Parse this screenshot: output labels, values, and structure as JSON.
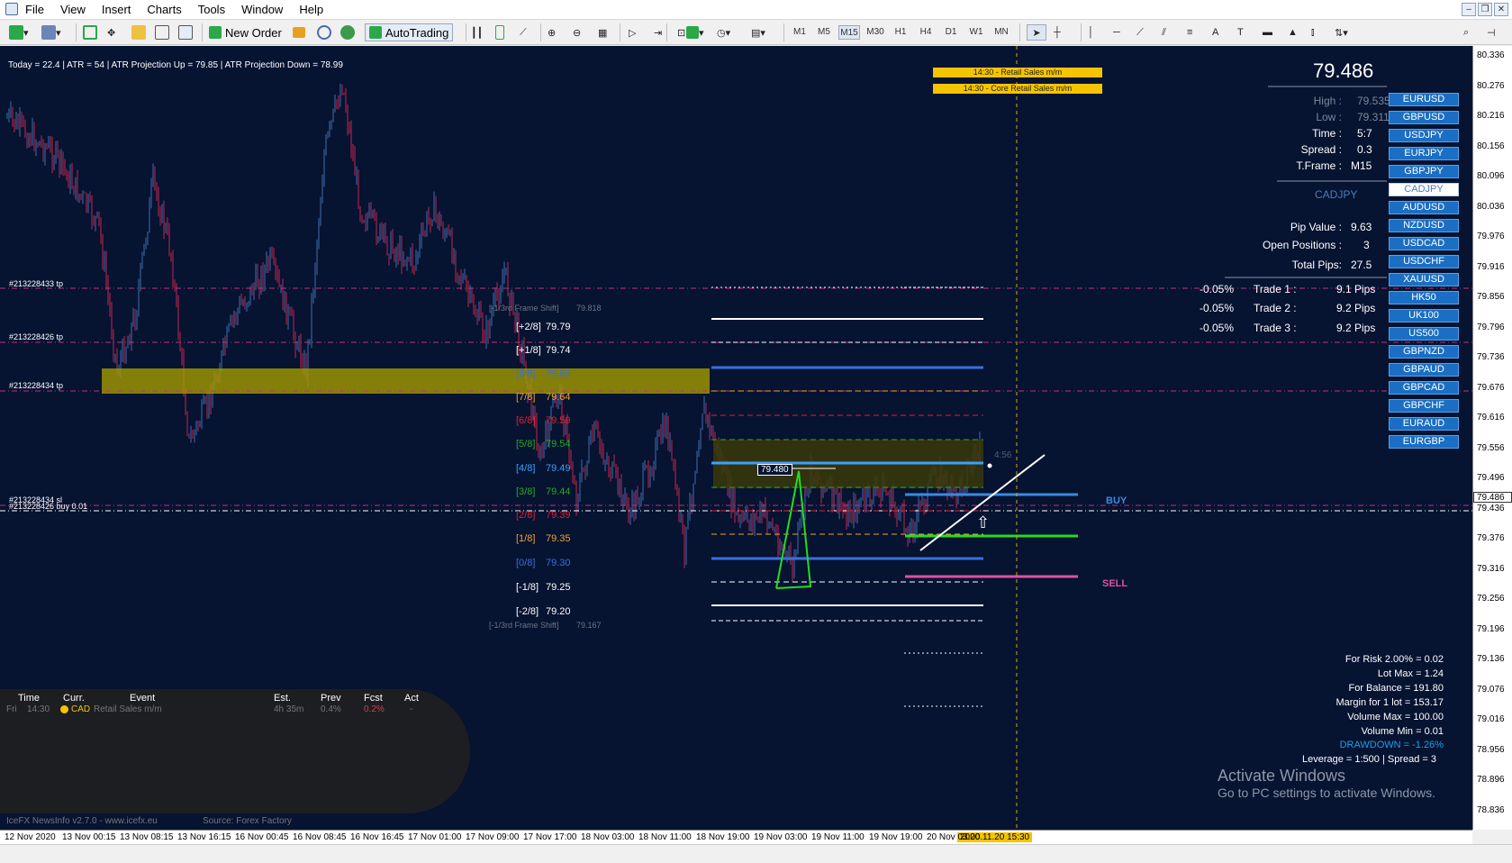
{
  "menubar": {
    "items": [
      "File",
      "View",
      "Insert",
      "Charts",
      "Tools",
      "Window",
      "Help"
    ]
  },
  "toolbar": {
    "new_order": "New Order",
    "autotrading": "AutoTrading",
    "timeframes": [
      "M1",
      "M5",
      "M15",
      "M30",
      "H1",
      "H4",
      "D1",
      "W1",
      "MN"
    ],
    "active_timeframe": "M15"
  },
  "chart": {
    "symbol": "CADJPY",
    "top_info": "Today = 22.4   |   ATR = 54   |   ATR Projection Up = 79.85   |   ATR Projection Down = 78.99",
    "current_price": "79.486",
    "info_panel": {
      "high_label": "High :",
      "high": "79.535",
      "low_label": "Low :",
      "low": "79.311",
      "time_label": "Time :",
      "time": "5:7",
      "spread_label": "Spread :",
      "spread": "0.3",
      "tframe_label": "T.Frame :",
      "tframe": "M15",
      "symbol": "CADJPY",
      "pip_value_label": "Pip Value :",
      "pip_value": "9.63",
      "open_positions_label": "Open Positions :",
      "open_positions": "3",
      "total_pips_label": "Total Pips:",
      "total_pips": "27.5",
      "trades": [
        {
          "pct": "-0.05%",
          "label": "Trade 1 :",
          "pips": "9.1 Pips"
        },
        {
          "pct": "-0.05%",
          "label": "Trade 2 :",
          "pips": "9.2 Pips"
        },
        {
          "pct": "-0.05%",
          "label": "Trade 3 :",
          "pips": "9.2 Pips"
        }
      ]
    },
    "pair_buttons": [
      "EURUSD",
      "GBPUSD",
      "USDJPY",
      "EURJPY",
      "GBPJPY",
      "CADJPY",
      "AUDUSD",
      "NZDUSD",
      "USDCAD",
      "USDCHF",
      "XAUUSD",
      "HK50",
      "UK100",
      "US500",
      "GBPNZD",
      "GBPAUD",
      "GBPCAD",
      "GBPCHF",
      "EURAUD",
      "EURGBP"
    ],
    "selected_pair": "CADJPY",
    "events": [
      "14:30 - Retail Sales m/m",
      "14:30 - Core Retail Sales m/m"
    ],
    "order_labels": {
      "tp1": "#213228433 tp",
      "tp2": "#213228426 tp",
      "tp3": "#213228434 tp",
      "buy_sl": "#213228434 sl",
      "buy_line": "#213228426 buy 0.01"
    },
    "murrey_levels": [
      {
        "label": "[-1/3rd Frame Shift]",
        "value": "79.818",
        "color": "#6f7585"
      },
      {
        "label": "[+2/8]",
        "value": "79.79",
        "color": "#ffffff"
      },
      {
        "label": "[+1/8]",
        "value": "79.74",
        "color": "#ffffff"
      },
      {
        "label": "[8/8]",
        "value": "79.69",
        "color": "#3a6fe0"
      },
      {
        "label": "[7/8]",
        "value": "79.64",
        "color": "#f0a030"
      },
      {
        "label": "[6/8]",
        "value": "79.59",
        "color": "#e02030"
      },
      {
        "label": "[5/8]",
        "value": "79.54",
        "color": "#2aa82a"
      },
      {
        "label": "[4/8]",
        "value": "79.49",
        "color": "#3aa0ff"
      },
      {
        "label": "[3/8]",
        "value": "79.44",
        "color": "#2aa82a"
      },
      {
        "label": "[2/8]",
        "value": "79.39",
        "color": "#e02030"
      },
      {
        "label": "[1/8]",
        "value": "79.35",
        "color": "#f0a030"
      },
      {
        "label": "[0/8]",
        "value": "79.30",
        "color": "#3a6fe0"
      },
      {
        "label": "[-1/8]",
        "value": "79.25",
        "color": "#ffffff"
      },
      {
        "label": "[-2/8]",
        "value": "79.20",
        "color": "#ffffff"
      },
      {
        "label": "[-1/3rd Frame Shift]",
        "value": "79.167",
        "color": "#6f7585"
      }
    ],
    "price_box": "79.480",
    "countdown": "4:56",
    "buy_label": "BUY",
    "sell_label": "SELL",
    "news": {
      "headers": [
        "Time",
        "Curr.",
        "Event",
        "Est.",
        "Prev",
        "Fcst",
        "Act"
      ],
      "row": {
        "day": "Fri",
        "time": "14:30",
        "curr": "CAD",
        "event": "Retail Sales m/m",
        "est": "4h 35m",
        "prev": "0.4%",
        "fcst": "0.2%",
        "act": "-"
      },
      "footer_left": "IceFX NewsInfo v2.7.0  -  www.icefx.eu",
      "footer_right": "Source: Forex Factory"
    },
    "account": {
      "risk": "For Risk 2.00% = 0.02",
      "lot_max": "Lot Max = 1.24",
      "balance": "For Balance = 191.80",
      "margin": "Margin for 1 lot = 153.17",
      "volume_max": "Volume Max = 100.00",
      "volume_min": "Volume Min = 0.01",
      "drawdown": "DRAWDOWN = -1.26%",
      "leverage": "Leverage = 1:500 | Spread = 3"
    },
    "watermark": {
      "title": "Activate Windows",
      "sub": "Go to PC settings to activate Windows."
    }
  },
  "price_scale": [
    "80.336",
    "80.276",
    "80.216",
    "80.156",
    "80.096",
    "80.036",
    "79.976",
    "79.916",
    "79.856",
    "79.796",
    "79.736",
    "79.676",
    "79.616",
    "79.556",
    "79.496",
    "79.436",
    "79.376",
    "79.316",
    "79.256",
    "79.196",
    "79.136",
    "79.076",
    "79.016",
    "78.956",
    "78.896",
    "78.836"
  ],
  "current_price_tag": "79.486",
  "time_scale": [
    "12 Nov 2020",
    "13 Nov 00:15",
    "13 Nov 08:15",
    "13 Nov 16:15",
    "16 Nov 00:45",
    "16 Nov 08:45",
    "16 Nov 16:45",
    "17 Nov 01:00",
    "17 Nov 09:00",
    "17 Nov 17:00",
    "18 Nov 03:00",
    "18 Nov 11:00",
    "18 Nov 19:00",
    "19 Nov 03:00",
    "19 Nov 11:00",
    "19 Nov 19:00",
    "20 Nov 03:00"
  ],
  "time_highlight": "2020.11.20 15:30",
  "colors": {
    "chart_bg": "#061331",
    "bull": "#3d6fb0",
    "bear": "#c7254e",
    "zone": "#a39b00"
  }
}
